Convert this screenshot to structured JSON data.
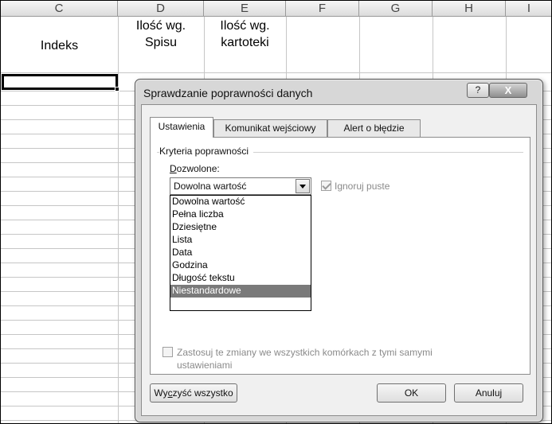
{
  "sheet": {
    "columns": [
      "C",
      "D",
      "E",
      "F",
      "G",
      "H",
      "I"
    ],
    "header_cells": {
      "c": "Indeks",
      "d_line1": "Ilość wg.",
      "d_line2": "Spisu",
      "e_line1": "Ilość wg.",
      "e_line2": "kartoteki"
    }
  },
  "dialog": {
    "title": "Sprawdzanie poprawności danych",
    "help_label": "?",
    "close_label": "X",
    "tabs": [
      {
        "label": "Ustawienia",
        "active": true
      },
      {
        "label": "Komunikat wejściowy",
        "active": false
      },
      {
        "label": "Alert o błędzie",
        "active": false
      }
    ],
    "group_label": "Kryteria poprawności",
    "allow_label_underlined": "D",
    "allow_label_rest": "ozwolone:",
    "allow_value": "Dowolna wartość",
    "ignore_blank_label": "Ignoruj puste",
    "ignore_blank_checked": true,
    "dropdown_options": [
      "Dowolna wartość",
      "Pełna liczba",
      "Dziesiętne",
      "Lista",
      "Data",
      "Godzina",
      "Długość tekstu",
      "Niestandardowe"
    ],
    "dropdown_selected": "Niestandardowe",
    "apply_all_line1": "Zastosuj te zmiany we wszystkich komórkach z tymi samymi",
    "apply_all_line2": "ustawieniami",
    "apply_all_checked": false,
    "clear_all_pre": "Wy",
    "clear_all_underlined": "c",
    "clear_all_post": "zyść wszystko",
    "ok_label": "OK",
    "cancel_label": "Anuluj"
  }
}
